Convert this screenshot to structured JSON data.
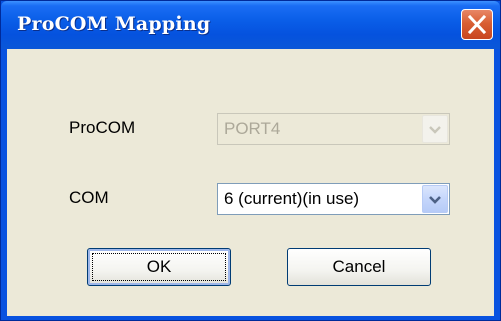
{
  "window": {
    "title": "ProCOM Mapping"
  },
  "icons": {
    "close": "close-icon",
    "dropdown": "chevron-down-icon"
  },
  "colors": {
    "titlebar": "#0a5ee8",
    "client_background": "#ece9d8",
    "close_button": "#d95f34"
  },
  "form": {
    "procom": {
      "label": "ProCOM",
      "value": "PORT4",
      "disabled": true
    },
    "com": {
      "label": "COM",
      "value": "6 (current)(in use)"
    }
  },
  "buttons": {
    "ok": "OK",
    "cancel": "Cancel"
  }
}
